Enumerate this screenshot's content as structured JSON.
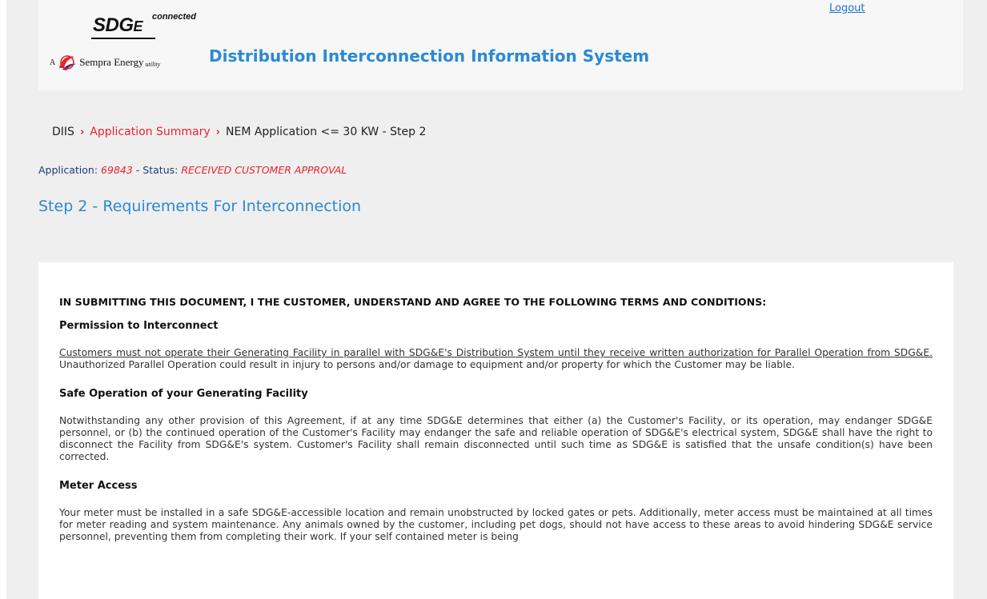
{
  "header": {
    "logout_label": "Logout",
    "site_title": "Distribution Interconnection Information System",
    "logo": {
      "brand": "SDG",
      "brand_e": "E",
      "tagline": "connected",
      "prefix": "A",
      "company": "Sempra Energy",
      "suffix": "utility"
    }
  },
  "breadcrumb": {
    "home": "DIIS",
    "separator": "›",
    "link": "Application Summary",
    "current": "NEM Application <= 30 KW - Step 2"
  },
  "application": {
    "label": "Application:",
    "id": "69843",
    "dash": "-",
    "status_label": "Status:",
    "status": "RECEIVED CUSTOMER APPROVAL"
  },
  "step_title": "Step 2 - Requirements For Interconnection",
  "terms": {
    "heading": "IN SUBMITTING THIS DOCUMENT, I THE CUSTOMER, UNDERSTAND AND AGREE TO THE FOLLOWING TERMS AND CONDITIONS:",
    "sections": [
      {
        "title": "Permission to Interconnect",
        "underlined": "Customers must not operate their Generating Facility in parallel with SDG&E's Distribution System until they receive written authorization for Parallel Operation from SDG&E.",
        "body": " Unauthorized Parallel Operation could result in injury to persons and/or damage to equipment and/or property for which the Customer may be liable."
      },
      {
        "title": "Safe Operation of your Generating Facility",
        "body": "Notwithstanding any other provision of this Agreement, if at any time SDG&E determines that either (a) the Customer's Facility, or its operation, may endanger SDG&E personnel, or (b) the continued operation of the Customer's Facility may endanger the safe and reliable operation of SDG&E's electrical system, SDG&E shall have the right to disconnect the Facility from SDG&E's system. Customer's Facility shall remain disconnected until such time as SDG&E is satisfied that the unsafe condition(s) have been corrected."
      },
      {
        "title": "Meter Access",
        "body": "Your meter must be installed in a safe SDG&E-accessible location and remain unobstructed by locked gates or pets. Additionally, meter access must be maintained at all times for meter reading and system maintenance. Any animals owned by the customer, including pet dogs, should not have access to these areas to avoid hindering SDG&E service personnel, preventing them from completing their work. If your self contained meter is being"
      }
    ]
  },
  "colors": {
    "accent_blue": "#2a8ad4",
    "link_red": "#e8232a",
    "status_navy": "#1e3b7a",
    "page_bg": "#efefef"
  }
}
